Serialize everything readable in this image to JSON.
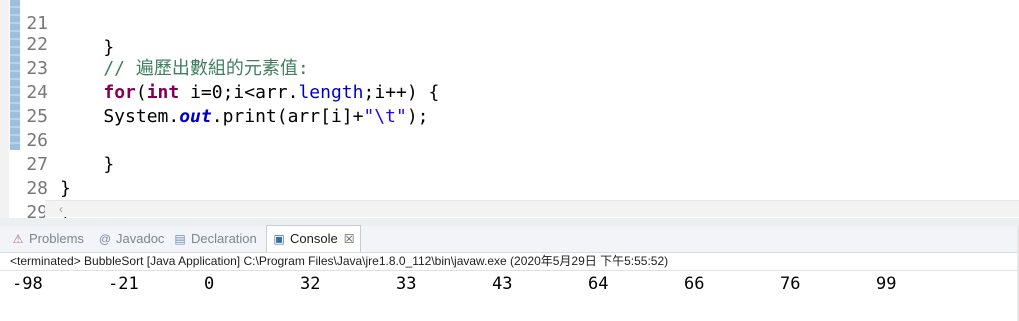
{
  "editor": {
    "lines": [
      {
        "num": "21",
        "text": "    }"
      },
      {
        "num": "22",
        "comment": "    // 遍歷出數組的元素值:"
      },
      {
        "num": "23",
        "kw1": "for",
        "p1": "(",
        "kw2": "int",
        "p2": " i=0;i<arr.",
        "field": "length",
        "p3": ";i++) {"
      },
      {
        "num": "24",
        "a": "    System.",
        "static": "out",
        "b": ".print(arr[i]+",
        "str": "\"\\t\"",
        "c": ");"
      },
      {
        "num": "25",
        "text": ""
      },
      {
        "num": "26",
        "text": "    }"
      },
      {
        "num": "27",
        "text": "}"
      },
      {
        "num": "28",
        "text": "}"
      },
      {
        "num": "29",
        "text": ""
      }
    ]
  },
  "views": {
    "tabs": [
      {
        "label": "Problems",
        "icon": "problems-icon"
      },
      {
        "label": "Javadoc",
        "icon": "at-icon"
      },
      {
        "label": "Declaration",
        "icon": "declaration-icon"
      },
      {
        "label": "Console",
        "icon": "console-icon"
      }
    ],
    "close_glyph": "☒"
  },
  "console": {
    "status": "<terminated> BubbleSort [Java Application] C:\\Program Files\\Java\\jre1.8.0_112\\bin\\javaw.exe (2020年5月29日 下午5:55:52)",
    "output": [
      "-98",
      "-21",
      "0",
      "32",
      "33",
      "43",
      "64",
      "66",
      "76",
      "99"
    ]
  }
}
